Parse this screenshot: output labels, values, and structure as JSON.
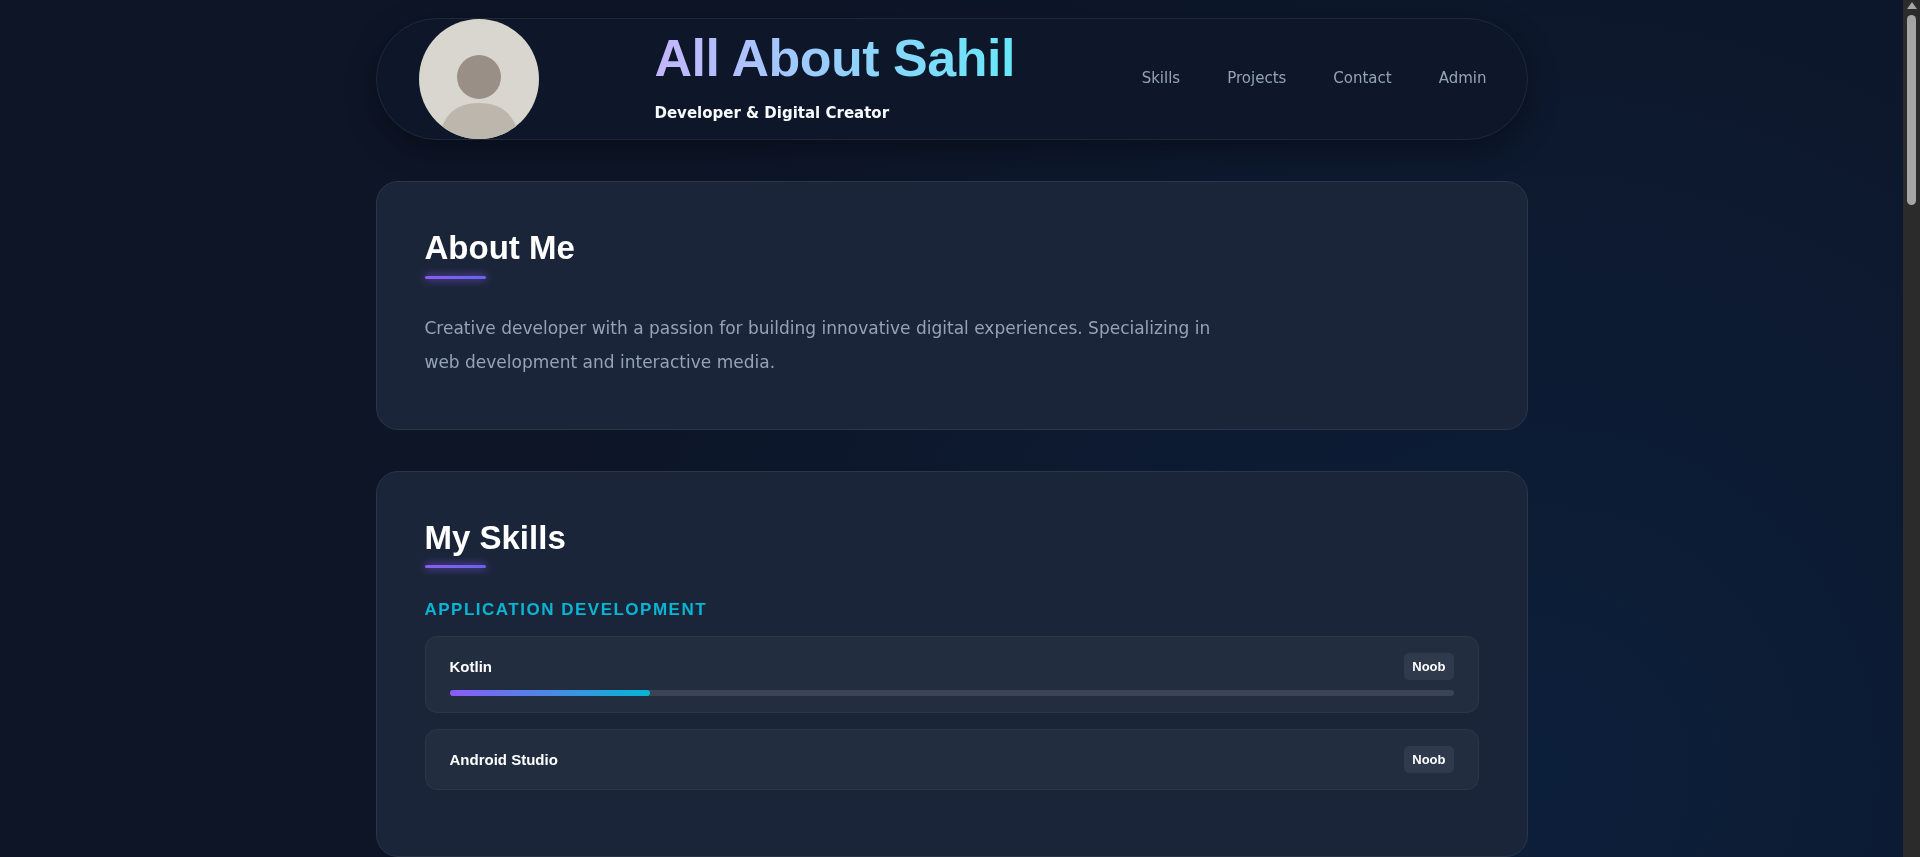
{
  "header": {
    "title_parts": [
      "All About ",
      "Sahil"
    ],
    "subtitle": "Developer & Digital Creator",
    "nav": [
      "Skills",
      "Projects",
      "Contact",
      "Admin"
    ]
  },
  "about": {
    "heading": "About Me",
    "text": "Creative developer with a passion for building innovative digital experiences. Specializing in web development and interactive media."
  },
  "skills": {
    "heading": "My Skills",
    "groups": [
      {
        "title": "APPLICATION DEVELOPMENT",
        "items": [
          {
            "name": "Kotlin",
            "badge": "Noob",
            "level": 0.2
          },
          {
            "name": "Android Studio",
            "badge": "Noob"
          }
        ]
      }
    ]
  }
}
